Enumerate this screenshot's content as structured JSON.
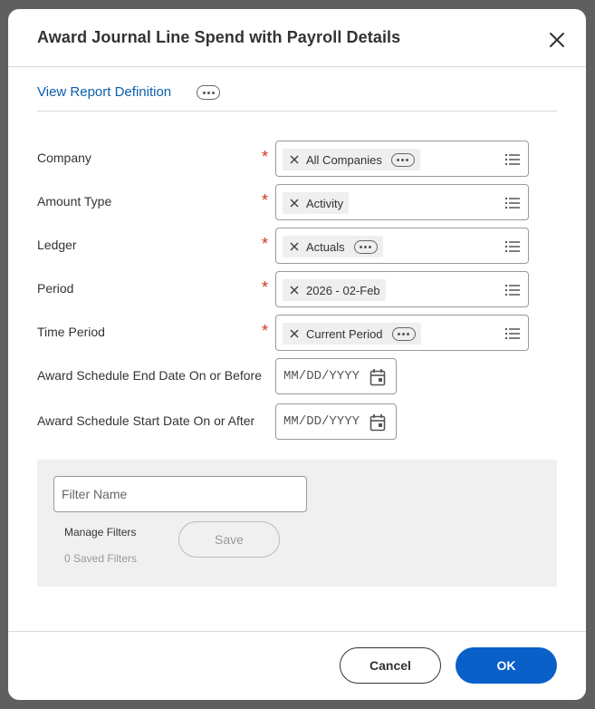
{
  "dialog": {
    "title": "Award Journal Line Spend with Payroll Details",
    "report_link": "View Report Definition"
  },
  "fields": [
    {
      "label": "Company",
      "required": true,
      "value": "All Companies",
      "has_more": true
    },
    {
      "label": "Amount Type",
      "required": true,
      "value": "Activity",
      "has_more": false
    },
    {
      "label": "Ledger",
      "required": true,
      "value": "Actuals",
      "has_more": true
    },
    {
      "label": "Period",
      "required": true,
      "value": "2026 - 02-Feb",
      "has_more": false
    },
    {
      "label": "Time Period",
      "required": true,
      "value": "Current Period",
      "has_more": true
    }
  ],
  "date_fields": [
    {
      "label": "Award Schedule End Date On or Before",
      "placeholder": "MM/DD/YYYY"
    },
    {
      "label": "Award Schedule Start Date On or After",
      "placeholder": "MM/DD/YYYY"
    }
  ],
  "filters": {
    "name_placeholder": "Filter Name",
    "manage_label": "Manage Filters",
    "saved_count_label": "0 Saved Filters",
    "save_label": "Save"
  },
  "footer": {
    "cancel_label": "Cancel",
    "ok_label": "OK"
  },
  "colors": {
    "link": "#0b5fad",
    "required": "#d1341b",
    "primary": "#0b5fc9",
    "backdrop": "#5f5f5f"
  }
}
